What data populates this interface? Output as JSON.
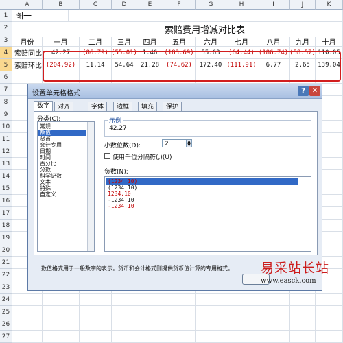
{
  "sheet": {
    "column_headers": [
      "A",
      "B",
      "C",
      "D",
      "E",
      "F",
      "G",
      "H",
      "I",
      "J",
      "K"
    ],
    "row_headers": [
      "1",
      "2",
      "3",
      "4",
      "5",
      "6",
      "7",
      "8",
      "9",
      "10",
      "11",
      "12",
      "13",
      "14",
      "15",
      "16",
      "17",
      "18",
      "19",
      "20",
      "21",
      "22",
      "23",
      "24",
      "25",
      "26",
      "27"
    ],
    "caption": "图一",
    "table_title": "索赔费用增减对比表",
    "header_label": "月份",
    "months": [
      "一月",
      "二月",
      "三月",
      "四月",
      "五月",
      "六月",
      "七月",
      "八月",
      "九月",
      "十月"
    ],
    "rows": [
      {
        "label": "索赔同比",
        "values": [
          "42.27",
          "(86.79)",
          "(55.01)",
          "1.46",
          "(183.69)",
          "55.63",
          "(64.44)",
          "(186.74)",
          "(58.57)",
          "110.05"
        ],
        "negative": [
          false,
          true,
          true,
          false,
          true,
          false,
          true,
          true,
          true,
          false
        ]
      },
      {
        "label": "索赔环比",
        "values": [
          "(204.92)",
          "11.14",
          "54.64",
          "21.28",
          "(74.62)",
          "172.40",
          "(111.91)",
          "6.77",
          "2.65",
          "139.04"
        ],
        "negative": [
          true,
          false,
          false,
          false,
          true,
          false,
          true,
          false,
          false,
          false
        ]
      }
    ],
    "selected_rows": [
      "4",
      "5"
    ]
  },
  "dialog": {
    "title": "设置单元格格式",
    "help_button": "?",
    "close_button": "✕",
    "tabs": [
      "数字",
      "对齐",
      "字体",
      "边框",
      "填充",
      "保护"
    ],
    "active_tab": "数字",
    "category_label": "分类(C):",
    "categories": [
      "常规",
      "数值",
      "货币",
      "会计专用",
      "日期",
      "时间",
      "百分比",
      "分数",
      "科学记数",
      "文本",
      "特殊",
      "自定义"
    ],
    "selected_category": "数值",
    "sample_label": "示例",
    "sample_value": "42.27",
    "decimal_label": "小数位数(D):",
    "decimal_value": "2",
    "thousands_label": "使用千位分隔符(,)(U)",
    "thousands_checked": false,
    "negative_label": "负数(N):",
    "negative_formats": [
      {
        "text": "(1234.10)",
        "red": true,
        "selected": true
      },
      {
        "text": "(1234.10)",
        "red": false,
        "selected": false
      },
      {
        "text": "1234.10",
        "red": true,
        "selected": false
      },
      {
        "text": "-1234.10",
        "red": false,
        "selected": false
      },
      {
        "text": "-1234.10",
        "red": true,
        "selected": false
      }
    ],
    "description": "数值格式用于一般数字的表示。货币和会计格式则提供货币值计算的专用格式。"
  },
  "watermark": {
    "site_name": "易采站长站",
    "url": "www.easck.com"
  },
  "colors": {
    "accent_red": "#d21e1e",
    "negative_red": "#c00000",
    "selection_blue": "#3169c6",
    "title_blue": "#a9c0e2"
  }
}
